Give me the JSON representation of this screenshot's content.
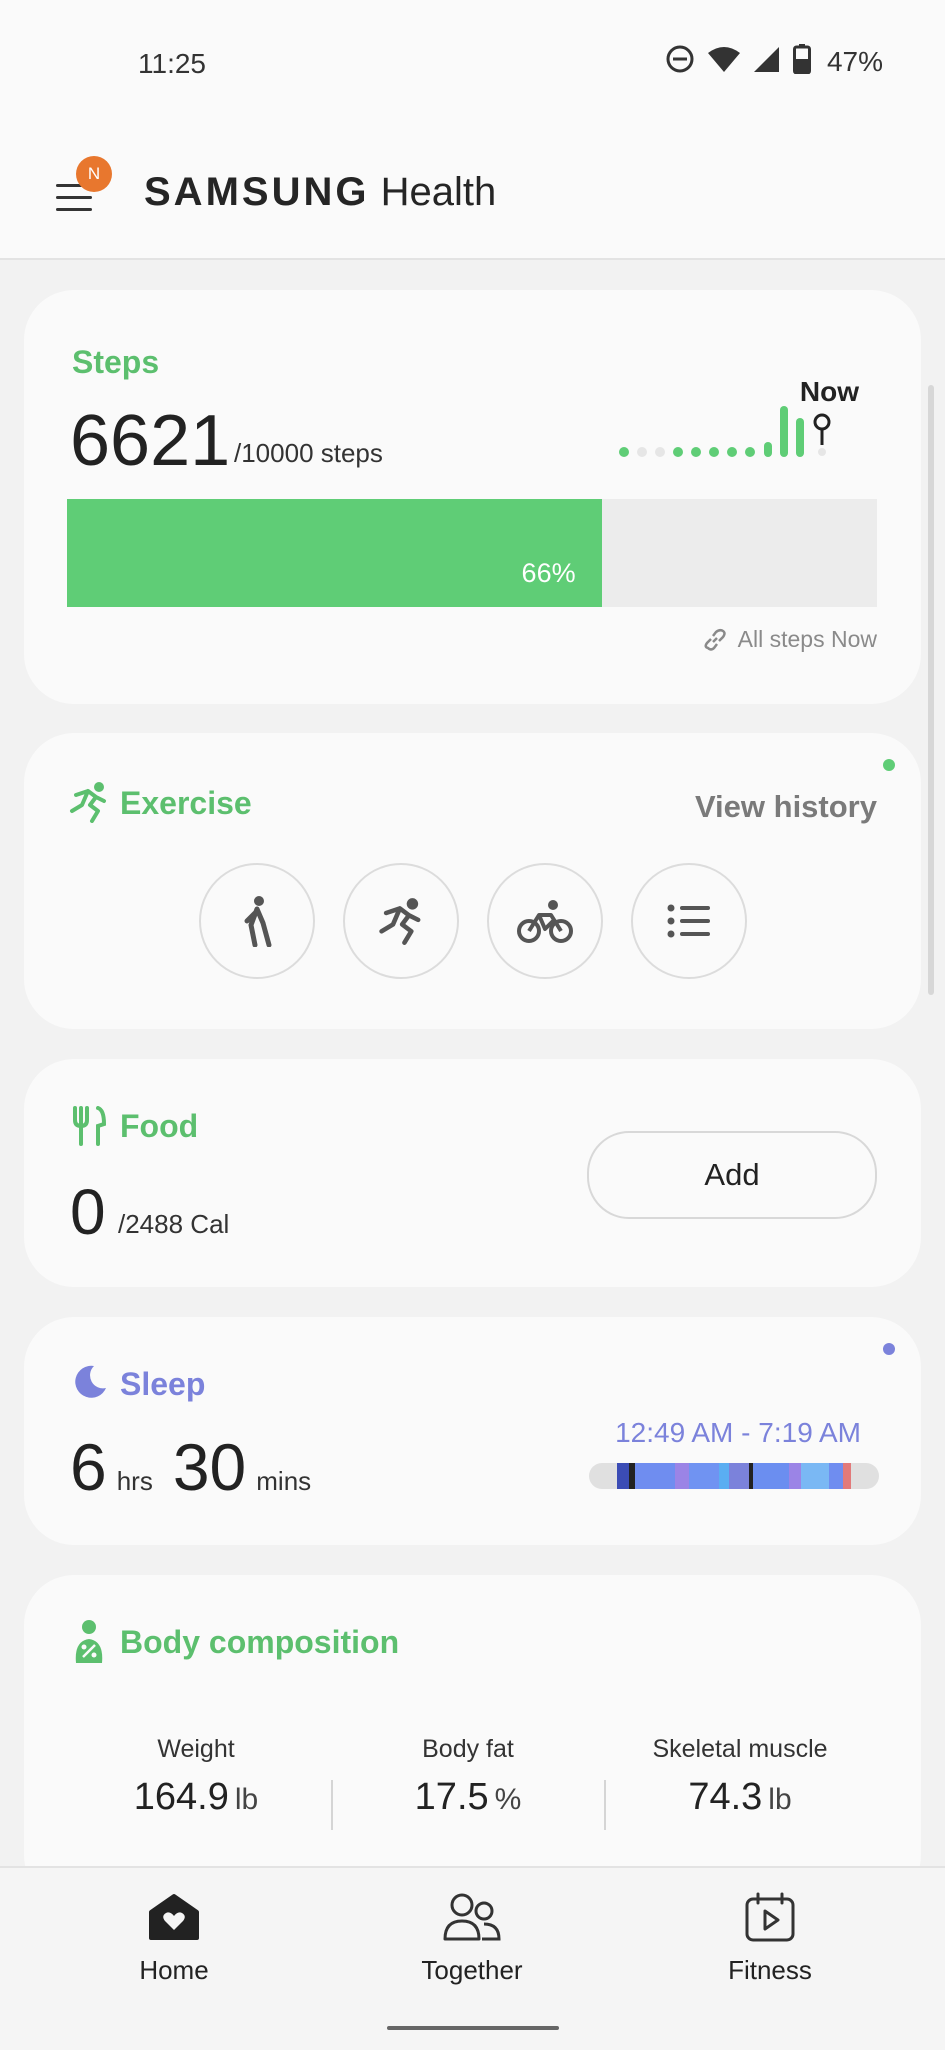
{
  "status_bar": {
    "time": "11:25",
    "battery": "47%"
  },
  "app_bar": {
    "brand_bold": "SAMSUNG",
    "brand_light": "Health",
    "notification_letter": "N"
  },
  "steps": {
    "title": "Steps",
    "count": "6621",
    "goal": "/10000 steps",
    "percent_label": "66%",
    "progress_fraction": 0.66,
    "now_label": "Now",
    "all_steps": "All steps Now"
  },
  "exercise": {
    "title": "Exercise",
    "view_history": "View history"
  },
  "food": {
    "title": "Food",
    "count": "0",
    "goal": "/2488 Cal",
    "add_label": "Add"
  },
  "sleep": {
    "title": "Sleep",
    "hours": "6",
    "hours_unit": "hrs",
    "minutes": "30",
    "minutes_unit": "mins",
    "range": "12:49 AM - 7:19 AM"
  },
  "body_composition": {
    "title": "Body composition",
    "metrics": [
      {
        "label": "Weight",
        "value": "164.9",
        "unit": "lb"
      },
      {
        "label": "Body fat",
        "value": "17.5",
        "unit": "%"
      },
      {
        "label": "Skeletal muscle",
        "value": "74.3",
        "unit": "lb"
      }
    ]
  },
  "bottom_nav": {
    "home": "Home",
    "together": "Together",
    "fitness": "Fitness"
  },
  "colors": {
    "accent_green": "#5fcd76",
    "sleep_purple": "#7b82db",
    "badge_orange": "#e8772e"
  }
}
